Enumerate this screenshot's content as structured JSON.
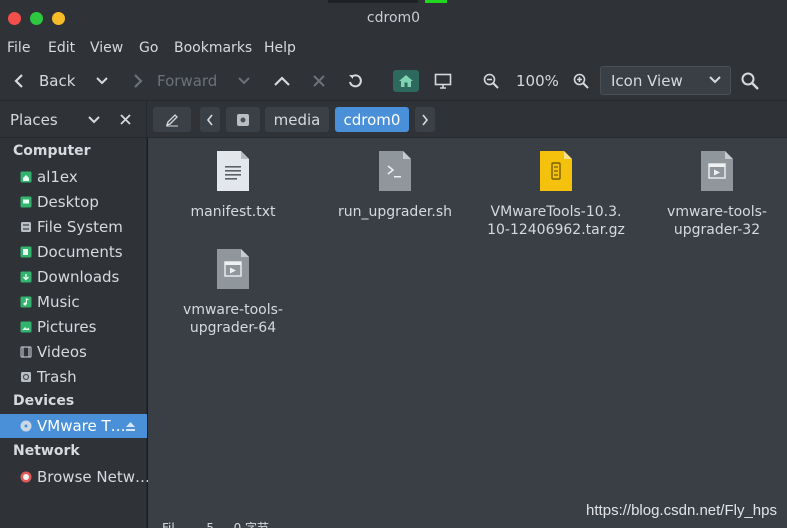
{
  "window": {
    "title": "cdrom0"
  },
  "menu": [
    "File",
    "Edit",
    "View",
    "Go",
    "Bookmarks",
    "Help"
  ],
  "toolbar": {
    "back_label": "Back",
    "forward_label": "Forward",
    "zoom_level": "100%",
    "view_mode": "Icon View"
  },
  "sidebar": {
    "places_label": "Places",
    "computer_header": "Computer",
    "computer_items": [
      {
        "label": "al1ex",
        "icon": "home-icon"
      },
      {
        "label": "Desktop",
        "icon": "desktop-icon"
      },
      {
        "label": "File System",
        "icon": "drive-icon"
      },
      {
        "label": "Documents",
        "icon": "folder-icon"
      },
      {
        "label": "Downloads",
        "icon": "folder-icon"
      },
      {
        "label": "Music",
        "icon": "music-folder-icon"
      },
      {
        "label": "Pictures",
        "icon": "pictures-folder-icon"
      },
      {
        "label": "Videos",
        "icon": "video-icon"
      },
      {
        "label": "Trash",
        "icon": "trash-icon"
      }
    ],
    "devices_header": "Devices",
    "devices_items": [
      {
        "label": "VMware T…",
        "icon": "optical-disc-icon"
      }
    ],
    "network_header": "Network",
    "network_items": [
      {
        "label": "Browse Netw…",
        "icon": "network-icon"
      }
    ]
  },
  "path": {
    "crumbs": [
      "media",
      "cdrom0"
    ],
    "active": "cdrom0"
  },
  "files": [
    {
      "name_lines": [
        "manifest.txt"
      ],
      "type": "text"
    },
    {
      "name_lines": [
        "run_upgrader.sh"
      ],
      "type": "script"
    },
    {
      "name_lines": [
        "VMwareTools-10.3.",
        "10-12406962.tar.gz"
      ],
      "type": "archive"
    },
    {
      "name_lines": [
        "vmware-tools-",
        "upgrader-32"
      ],
      "type": "executable"
    },
    {
      "name_lines": [
        "vmware-tools-",
        "upgrader-64"
      ],
      "type": "executable"
    }
  ],
  "status": "Fil… … 5 … 0 字节",
  "watermark": "https://blog.csdn.net/Fly_hps",
  "colors": {
    "accent": "#4a90d9",
    "window_bg": "#2f3338",
    "content_bg": "#3a3f45",
    "home_icon_bg": "#2d6a5d",
    "folder_green": "#32b36e",
    "archive_yellow": "#f4c20d"
  }
}
